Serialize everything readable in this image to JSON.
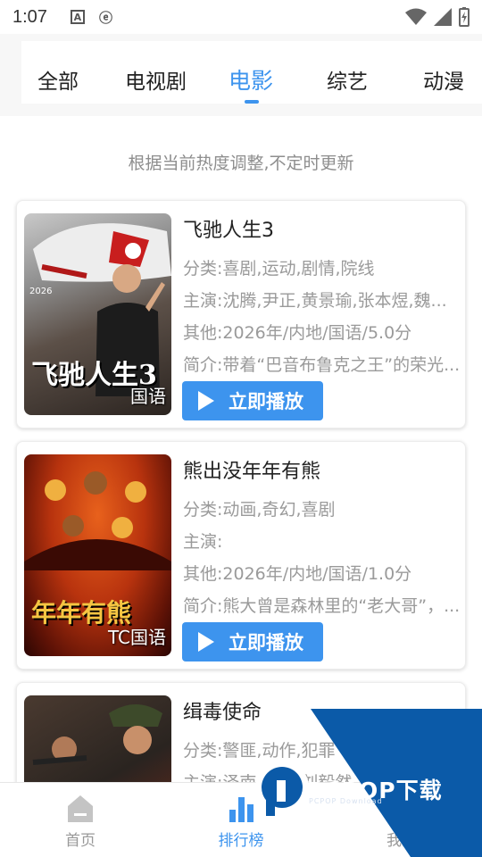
{
  "status_bar": {
    "time": "1:07"
  },
  "tabs": [
    {
      "label": "全部"
    },
    {
      "label": "电视剧"
    },
    {
      "label": "电影"
    },
    {
      "label": "综艺"
    },
    {
      "label": "动漫"
    }
  ],
  "active_tab_index": 2,
  "hint": "根据当前热度调整,不定时更新",
  "movies": [
    {
      "title": "飞驰人生3",
      "genre": "分类:喜剧,运动,剧情,院线",
      "cast": "主演:沈腾,尹正,黄景瑜,张本煜,魏...",
      "other": "其他:2026年/内地/国语/5.0分",
      "summary": "简介:带着“巴音布鲁克之王”的荣光...",
      "poster_tag": "国语",
      "poster_title": "飞驰人生3",
      "play_label": "立即播放"
    },
    {
      "title": "熊出没年年有熊",
      "genre": "分类:动画,奇幻,喜剧",
      "cast": "主演:",
      "other": "其他:2026年/内地/国语/1.0分",
      "summary": "简介:熊大曾是森林里的“老大哥”，...",
      "poster_tag": "TC国语",
      "poster_title": "年年有熊",
      "play_label": "立即播放"
    },
    {
      "title": "缉毒使命",
      "genre": "分类:警匪,动作,犯罪",
      "cast": "主演:泽南,以(?)刘毅然",
      "other": "",
      "summary": "",
      "poster_tag": "",
      "poster_title": "",
      "play_label": ""
    }
  ],
  "bottom_nav": [
    {
      "label": "首页",
      "icon": "home-icon"
    },
    {
      "label": "排行榜",
      "icon": "rank-chart-icon"
    },
    {
      "label": "我的",
      "icon": "user-icon"
    }
  ],
  "watermark": {
    "brand": "PCPOP下载",
    "sub": "PCPOP Download"
  },
  "colors": {
    "accent": "#3d94ee",
    "muted": "#9a9a9a",
    "watermark": "#0b5aa8"
  }
}
